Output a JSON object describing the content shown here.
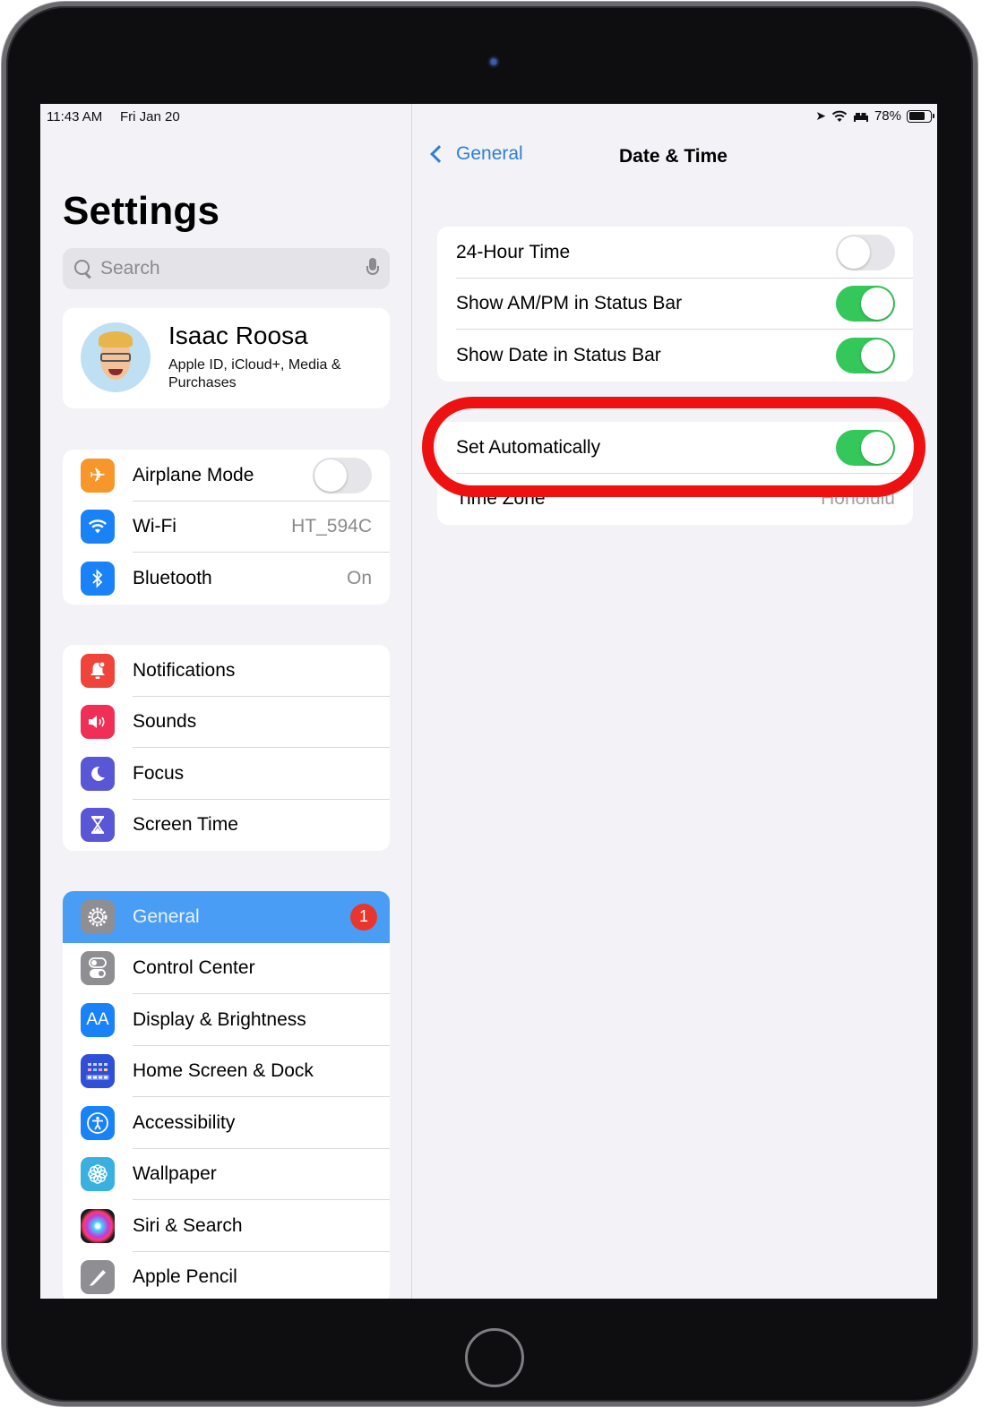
{
  "status_bar": {
    "time": "11:43 AM",
    "date": "Fri Jan 20",
    "battery": "78%",
    "battery_level": 0.78,
    "icons": [
      "location-arrow-icon",
      "wifi-icon",
      "sleep-bed-icon",
      "battery-icon"
    ]
  },
  "sidebar": {
    "title": "Settings",
    "search": {
      "placeholder": "Search",
      "value": ""
    },
    "profile": {
      "name": "Isaac Roosa",
      "subtitle": "Apple ID, iCloud+, Media & Purchases"
    },
    "groups": [
      {
        "items": [
          {
            "label": "Airplane Mode",
            "icon": "airplane-icon",
            "color": "#f7962b",
            "toggle": false
          },
          {
            "label": "Wi-Fi",
            "icon": "wifi-icon",
            "color": "#1a82f7",
            "value": "HT_594C"
          },
          {
            "label": "Bluetooth",
            "icon": "bluetooth-icon",
            "color": "#1a82f7",
            "value": "On"
          }
        ]
      },
      {
        "items": [
          {
            "label": "Notifications",
            "icon": "bell-icon",
            "color": "#f0443a"
          },
          {
            "label": "Sounds",
            "icon": "speaker-icon",
            "color": "#ef2f55"
          },
          {
            "label": "Focus",
            "icon": "moon-icon",
            "color": "#5a57d6"
          },
          {
            "label": "Screen Time",
            "icon": "hourglass-icon",
            "color": "#5a57d6"
          }
        ]
      },
      {
        "items": [
          {
            "label": "General",
            "icon": "gear-icon",
            "color": "#8e8e93",
            "badge": "1",
            "selected": true
          },
          {
            "label": "Control Center",
            "icon": "switches-icon",
            "color": "#8e8e93"
          },
          {
            "label": "Display & Brightness",
            "icon": "text-size-icon",
            "color": "#1a82f7",
            "glyph": "AA"
          },
          {
            "label": "Home Screen & Dock",
            "icon": "app-grid-icon",
            "color": "#2f4fd6"
          },
          {
            "label": "Accessibility",
            "icon": "accessibility-icon",
            "color": "#1a82f7"
          },
          {
            "label": "Wallpaper",
            "icon": "flower-icon",
            "color": "#3ab0e0"
          },
          {
            "label": "Siri & Search",
            "icon": "siri-icon",
            "color": "#222222"
          },
          {
            "label": "Apple Pencil",
            "icon": "pencil-icon",
            "color": "#8e8e93"
          }
        ]
      }
    ]
  },
  "detail": {
    "back_label": "General",
    "title": "Date & Time",
    "group1": [
      {
        "label": "24-Hour Time",
        "toggle": false
      },
      {
        "label": "Show AM/PM in Status Bar",
        "toggle": true
      },
      {
        "label": "Show Date in Status Bar",
        "toggle": true
      }
    ],
    "group2": [
      {
        "label": "Set Automatically",
        "toggle": true
      },
      {
        "label": "Time Zone",
        "value": "Honolulu"
      }
    ]
  },
  "annotation": {
    "target": "Set Automatically",
    "color": "#ee1111"
  },
  "colors": {
    "accent": "#2f7fd6",
    "toggle_on": "#34c759",
    "selected_row": "#4a9df5",
    "badge": "#e8362f"
  }
}
